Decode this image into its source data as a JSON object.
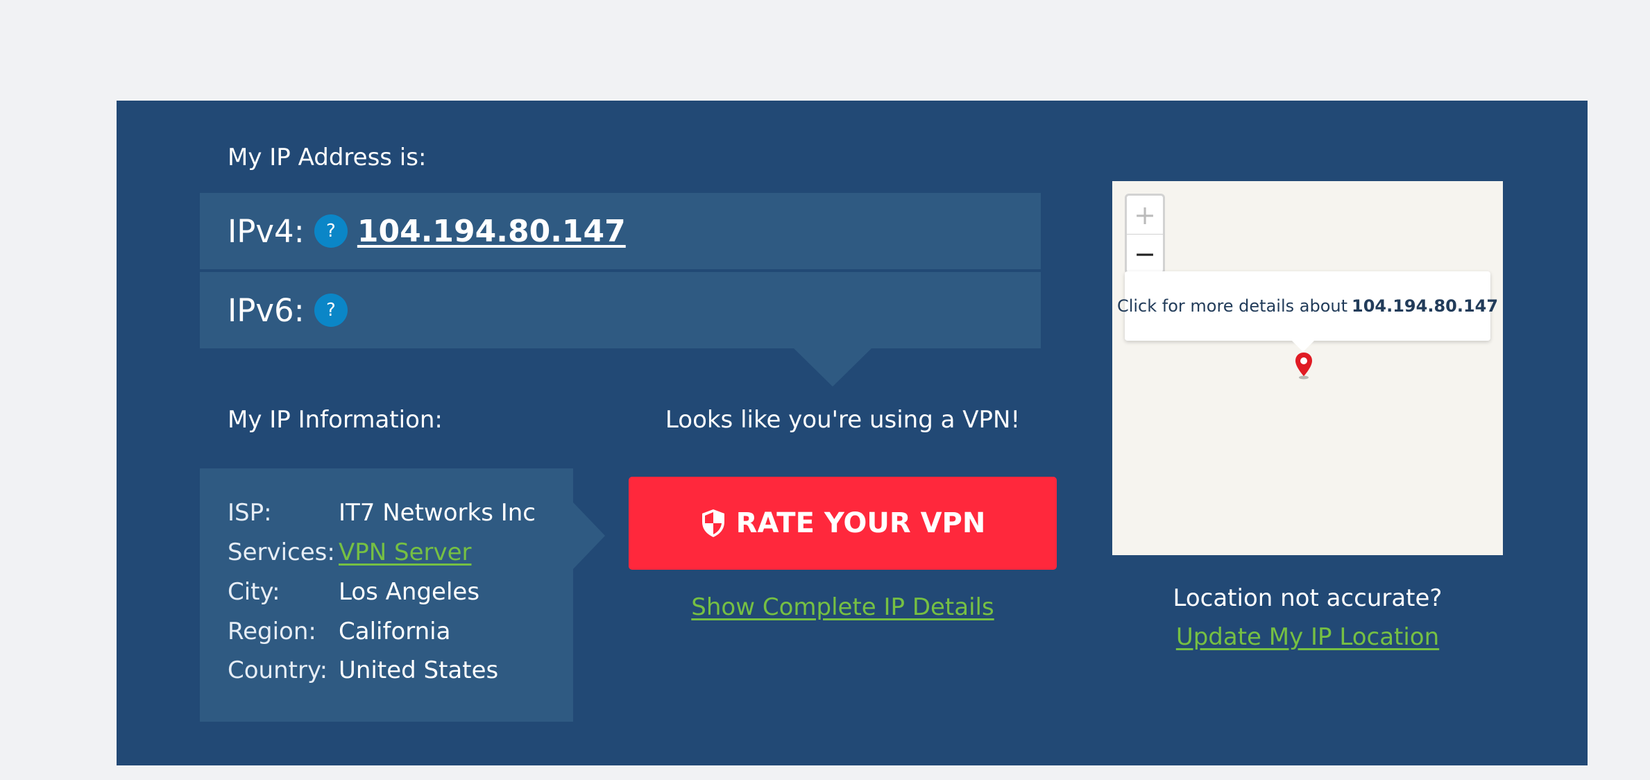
{
  "header": {
    "title": "My IP Address is:"
  },
  "ipv4": {
    "label": "IPv4:",
    "help": "?",
    "value": "104.194.80.147"
  },
  "ipv6": {
    "label": "IPv6:",
    "help": "?"
  },
  "info": {
    "title": "My IP Information:",
    "rows": [
      {
        "key": "ISP:",
        "value": "IT7 Networks Inc"
      },
      {
        "key": "Services:",
        "value": "VPN Server"
      },
      {
        "key": "City:",
        "value": "Los Angeles"
      },
      {
        "key": "Region:",
        "value": "California"
      },
      {
        "key": "Country:",
        "value": "United States"
      }
    ]
  },
  "vpn": {
    "message": "Looks like you're using a VPN!",
    "rate_label": "RATE YOUR VPN",
    "details_link": "Show Complete IP Details"
  },
  "map": {
    "zoom_in": "+",
    "zoom_out": "−",
    "popup_text": "Click for more details about",
    "popup_ip": "104.194.80.147",
    "location_question": "Location not accurate?",
    "update_link": "Update My IP Location"
  },
  "colors": {
    "panel": "#224975",
    "row": "#2f5a82",
    "accent_green": "#76c043",
    "button_red": "#ff283c",
    "help_blue": "#0b86c7"
  },
  "icons": [
    "help-icon",
    "shield-icon",
    "map-pin-icon"
  ]
}
